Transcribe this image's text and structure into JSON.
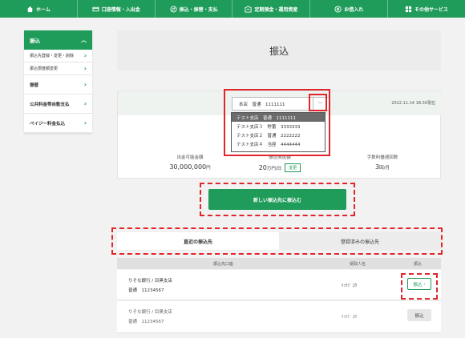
{
  "topnav": [
    {
      "label": "ホーム",
      "icon": "home-icon"
    },
    {
      "label": "口座情報・入出金",
      "icon": "card-icon"
    },
    {
      "label": "振込・振替・支払",
      "icon": "transfer-icon"
    },
    {
      "label": "定期預金・運用資産",
      "icon": "deposit-icon"
    },
    {
      "label": "お借入れ",
      "icon": "loan-icon"
    },
    {
      "label": "その他サービス",
      "icon": "grid-icon"
    }
  ],
  "sidebar": {
    "header": "振込",
    "items": [
      {
        "label": "振込先登録・変更・削除",
        "type": "sub"
      },
      {
        "label": "振込限度額変更",
        "type": "sub"
      },
      {
        "label": "振替",
        "type": "main"
      },
      {
        "label": "公共料金等自動支払",
        "type": "main"
      },
      {
        "label": "ペイジー料金払込",
        "type": "main"
      }
    ]
  },
  "page_title": "振込",
  "account": {
    "selected": "本店　普通　1111111",
    "date": "2022.11.14 18:30現在",
    "options": [
      "テスト支店　普通　1111111",
      "テスト支店３　貯蓄　3333333",
      "テスト支店２　普通　2222222",
      "テスト支店４　当座　4444444"
    ]
  },
  "stats": {
    "available_label": "出金可能金額",
    "available_value": "30,000,000",
    "available_unit": "円",
    "limit_label": "振込限度額",
    "limit_value": "20",
    "limit_unit": "万円/日",
    "change_label": "変更",
    "fee_label": "手数料優遇回数",
    "fee_value": "3",
    "fee_unit": "回/月"
  },
  "new_transfer_label": "新しい振込先に振込む",
  "tabs": [
    {
      "label": "直近の振込先",
      "active": true
    },
    {
      "label": "登録済みの振込先",
      "active": false
    }
  ],
  "table": {
    "headers": [
      "振込先口座",
      "受取人名",
      "振込"
    ],
    "rows": [
      {
        "bank": "りそな銀行 / 目黒支店",
        "account": "普通　11234567",
        "payee": "ﾘｿﾅｼﾞ ﾛｳ",
        "button": "振込"
      },
      {
        "bank": "りそな銀行 / 目黒支店",
        "account": "普通　11234567",
        "payee": "ﾘｿﾅｼﾞ ﾛｳ",
        "button": "振込"
      }
    ]
  },
  "colors": {
    "brand_green": "#1f9b5a",
    "highlight_red": "#e0262a"
  }
}
